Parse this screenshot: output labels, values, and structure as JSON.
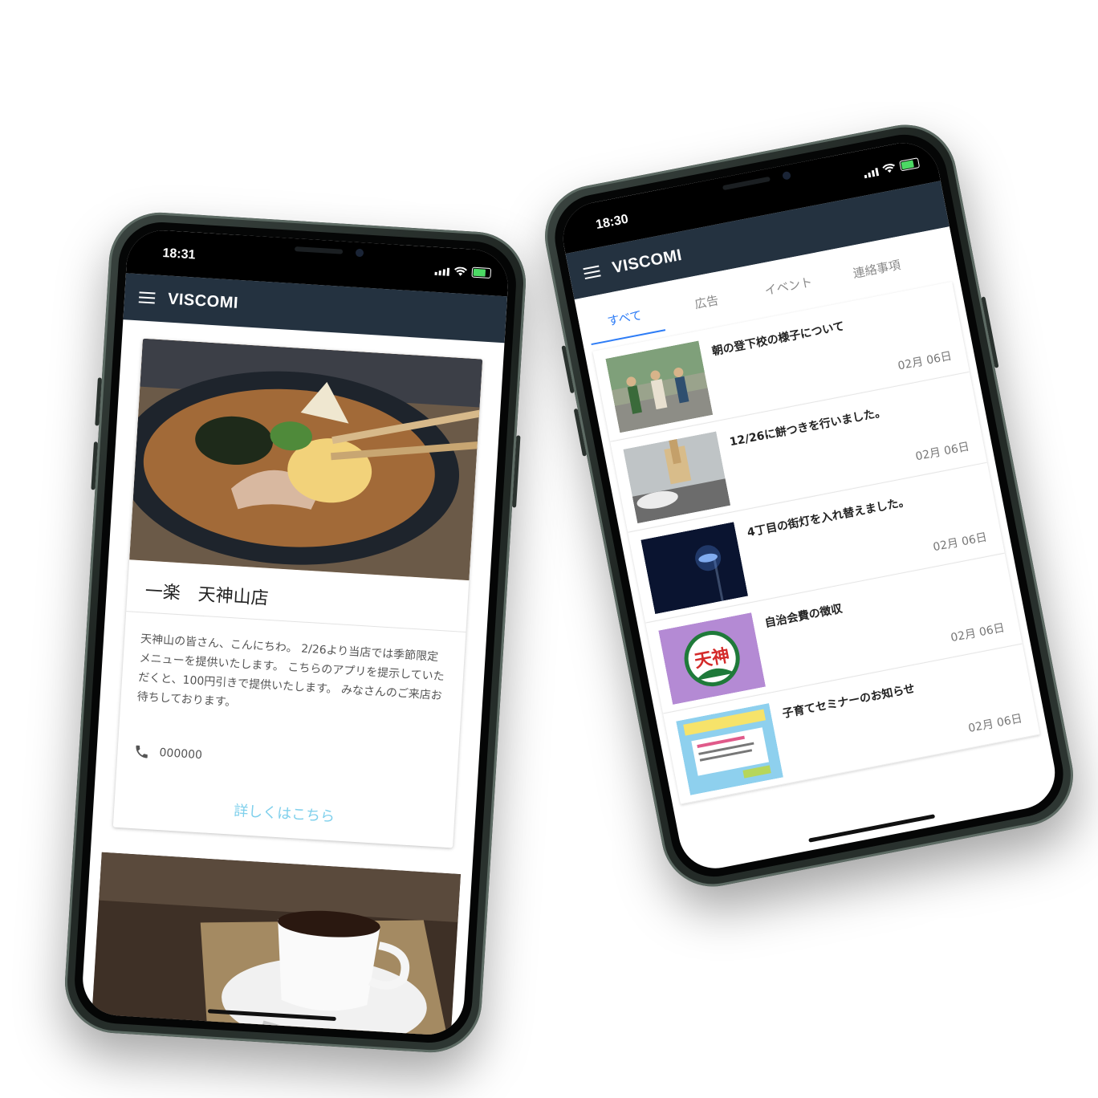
{
  "left_phone": {
    "status_time": "18:31",
    "app_title": "VISCOMI",
    "card": {
      "title": "一楽　天神山店",
      "body": "天神山の皆さん、こんにちわ。 2/26より当店では季節限定メニューを提供いたします。 こちらのアプリを提示していただくと、100円引きで提供いたします。 みなさんのご来店お待ちしております。",
      "phone": "000000",
      "link": "詳しくはこちら"
    }
  },
  "right_phone": {
    "status_time": "18:30",
    "app_title": "VISCOMI",
    "tabs": [
      "すべて",
      "広告",
      "イベント",
      "連絡事項"
    ],
    "items": [
      {
        "title": "朝の登下校の様子について",
        "date": "02月 06日"
      },
      {
        "title": "12/26に餅つきを行いました。",
        "date": "02月 06日"
      },
      {
        "title": "4丁目の街灯を入れ替えました。",
        "date": "02月 06日"
      },
      {
        "title": "自治会費の徴収",
        "date": "02月 06日"
      },
      {
        "title": "子育てセミナーのお知らせ",
        "date": "02月 06日"
      }
    ],
    "badge_text": "天神"
  },
  "colors": {
    "appbar": "#243240",
    "accent_tab": "#2d7cf6",
    "link": "#7fd0ec",
    "battery": "#4cd964"
  }
}
